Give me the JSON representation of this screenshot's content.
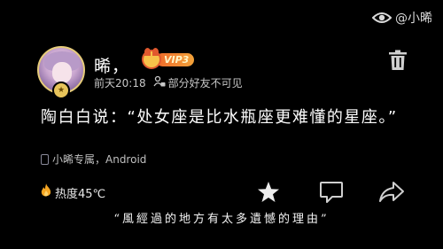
{
  "watermark": {
    "text": "@小晞"
  },
  "post": {
    "username": "晞，",
    "vip_label": "VIP3",
    "time": "前天20:18",
    "visibility": "部分好友不可见",
    "content": "陶白白说：“处女座是比水瓶座更难懂的星座。”",
    "source": "小晞专属，Android",
    "heat": "热度45℃"
  },
  "caption": "“風經過的地方有太多遺憾的理由”",
  "icons": {
    "watermark": "eye-icon",
    "avatar_badge": "star-badge-icon",
    "visibility": "person-lock-icon",
    "delete": "trash-icon",
    "source": "phone-icon",
    "heat": "flame-icon",
    "like": "star-icon",
    "comment": "comment-icon",
    "share": "share-icon"
  },
  "colors": {
    "background": "#000000",
    "vip_orange": "#f06a2a",
    "flame": "#f5a623",
    "text": "#ffffff"
  }
}
